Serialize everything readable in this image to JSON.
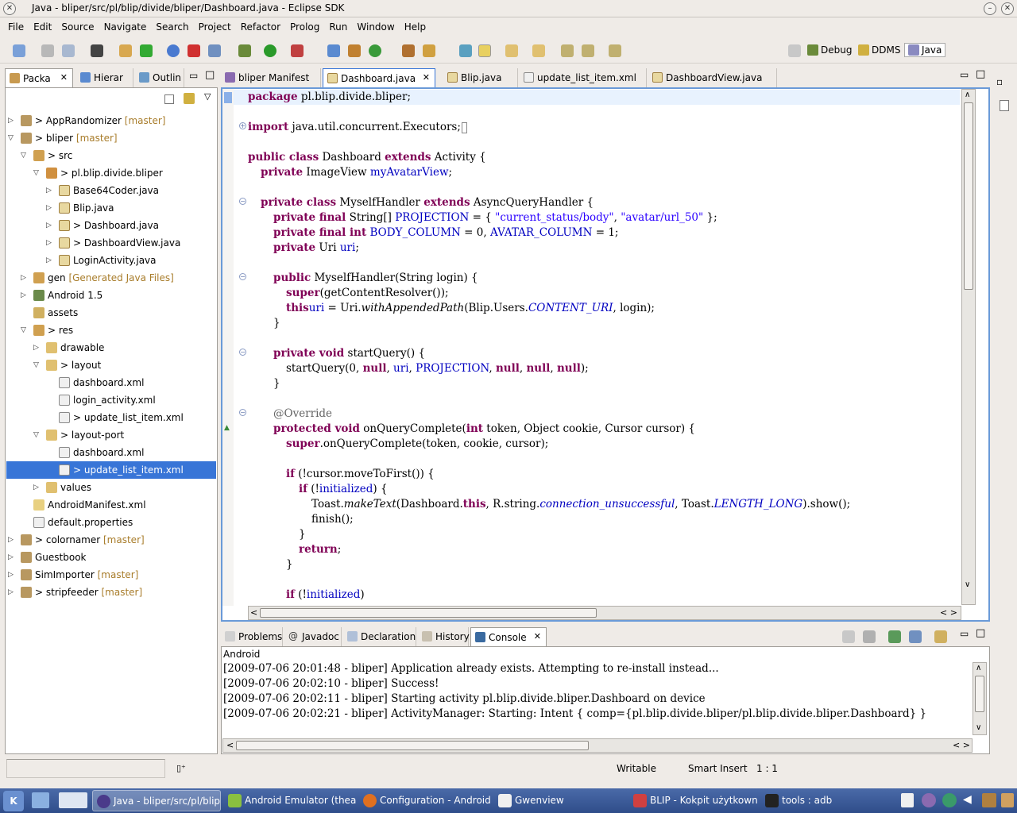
{
  "window": {
    "title": "Java - bliper/src/pl/blip/divide/bliper/Dashboard.java - Eclipse SDK"
  },
  "menu": [
    "File",
    "Edit",
    "Source",
    "Navigate",
    "Search",
    "Project",
    "Refactor",
    "Prolog",
    "Run",
    "Window",
    "Help"
  ],
  "perspectives": [
    "Debug",
    "DDMS",
    "Java"
  ],
  "left_tabs": [
    "Packa",
    "Hierar",
    "Outlin"
  ],
  "tree": [
    {
      "label": "> AppRandomizer",
      "tag": "[master]"
    },
    {
      "label": "> bliper",
      "tag": "[master]"
    },
    {
      "label": "> src",
      "tag": ""
    },
    {
      "label": "> pl.blip.divide.bliper",
      "tag": ""
    },
    {
      "label": "Base64Coder.java",
      "tag": ""
    },
    {
      "label": "Blip.java",
      "tag": ""
    },
    {
      "label": "> Dashboard.java",
      "tag": ""
    },
    {
      "label": "> DashboardView.java",
      "tag": ""
    },
    {
      "label": "LoginActivity.java",
      "tag": ""
    },
    {
      "label": "gen",
      "tag": "[Generated Java Files]"
    },
    {
      "label": "Android 1.5",
      "tag": ""
    },
    {
      "label": "assets",
      "tag": ""
    },
    {
      "label": "> res",
      "tag": ""
    },
    {
      "label": "drawable",
      "tag": ""
    },
    {
      "label": "> layout",
      "tag": ""
    },
    {
      "label": "dashboard.xml",
      "tag": ""
    },
    {
      "label": "login_activity.xml",
      "tag": ""
    },
    {
      "label": "> update_list_item.xml",
      "tag": ""
    },
    {
      "label": "> layout-port",
      "tag": ""
    },
    {
      "label": "dashboard.xml",
      "tag": ""
    },
    {
      "label": "> update_list_item.xml",
      "tag": ""
    },
    {
      "label": "values",
      "tag": ""
    },
    {
      "label": "AndroidManifest.xml",
      "tag": ""
    },
    {
      "label": "default.properties",
      "tag": ""
    },
    {
      "label": "> colornamer",
      "tag": "[master]"
    },
    {
      "label": "Guestbook",
      "tag": ""
    },
    {
      "label": "SimImporter",
      "tag": "[master]"
    },
    {
      "label": "> stripfeeder",
      "tag": "[master]"
    }
  ],
  "editor_tabs": [
    "bliper Manifest",
    "Dashboard.java",
    "Blip.java",
    "update_list_item.xml",
    "DashboardView.java"
  ],
  "code": {
    "l1a": "package",
    "l1b": " pl.blip.divide.bliper;",
    "l2a": "import",
    "l2b": " java.util.concurrent.Executors;",
    "l3a": "public class",
    "l3b": " Dashboard ",
    "l3c": "extends",
    "l3d": " Activity {",
    "l4a": "private",
    "l4b": " ImageView ",
    "l4c": "myAvatarView",
    ";": ";",
    "l5a": "private class",
    "l5b": " MyselfHandler ",
    "l5c": "extends",
    "l5d": " AsyncQueryHandler {",
    "l6a": "private final",
    "l6b": " String[] ",
    "l6c": "PROJECTION",
    "l6d": " = { ",
    "l6e": "\"current_status/body\"",
    "l6f": ", ",
    "l6g": "\"avatar/url_50\"",
    "l6h": " };",
    "l7a": "private final int",
    "l7b": " ",
    "l7c": "BODY_COLUMN",
    "l7d": " = 0, ",
    "l7e": "AVATAR_COLUMN",
    "l7f": " = 1;",
    "l8a": "private",
    "l8b": " Uri ",
    "l8c": "uri",
    "l9a": "public",
    "l9b": " MyselfHandler(String login) {",
    "l10a": "super",
    "l10b": "(getContentResolver());",
    "l11a": "this",
    ".": ".",
    "l11b": "uri",
    "l11c": " = Uri.",
    "l11d": "withAppendedPath",
    "l11e": "(Blip.Users.",
    "l11f": "CONTENT_URI",
    "l11g": ", login);",
    "close": "}",
    "l12a": "private void",
    "l12b": " startQuery() {",
    "l13a": "startQuery(0, ",
    "null": "null",
    "l13c": ", ",
    "l13d": "uri",
    "l13e": ", ",
    "l13f": "PROJECTION",
    "l13g": ", ",
    "l13h": "null",
    "l13i": ", ",
    "l13j": "null",
    "l13k": ", ",
    "l13l": "null",
    "l13m": ");",
    "l14": "@Override",
    "l15a": "protected void",
    "l15b": " onQueryComplete(",
    "l15c": "int",
    "l15d": " token, Object cookie, Cursor cursor) {",
    "l16a": "super",
    "l16b": ".onQueryComplete(token, cookie, cursor);",
    "l17a": "if",
    "l17b": " (!cursor.moveToFirst()) {",
    "l18a": "if",
    "l18b": " (!",
    "l18c": "initialized",
    "l18d": ") {",
    "l19a": "Toast.",
    "l19b": "makeText",
    "l19c": "(Dashboard.",
    "l19d": "this",
    "l19e": ", R.string.",
    "l19f": "connection_unsuccessful",
    "l19g": ", Toast.",
    "l19h": "LENGTH_LONG",
    "l19i": ").show();",
    "l20": "finish();",
    "l21a": "return",
    "l21b": ";",
    "l22a": "if",
    "l22b": " (!",
    "l22c": "initialized",
    "l22d": ")"
  },
  "bottom_tabs": [
    "Problems",
    "Javadoc",
    "Declaration",
    "History",
    "Console"
  ],
  "console": {
    "label": "Android",
    "lines": [
      "[2009-07-06 20:01:48 - bliper] Application already exists. Attempting to re-install instead...",
      "[2009-07-06 20:02:10 - bliper] Success!",
      "[2009-07-06 20:02:11 - bliper] Starting activity pl.blip.divide.bliper.Dashboard on device",
      "[2009-07-06 20:02:21 - bliper] ActivityManager: Starting: Intent { comp={pl.blip.divide.bliper/pl.blip.divide.bliper.Dashboard} }"
    ]
  },
  "status": {
    "writable": "Writable",
    "insert": "Smart Insert",
    "pos": "1 : 1"
  },
  "taskbar": [
    "Java - bliper/src/pl/blip/c",
    "Android Emulator (theavd",
    "Configuration - Android",
    "Gwenview",
    "BLIP - Kokpit użytkowni",
    "tools : adb"
  ]
}
